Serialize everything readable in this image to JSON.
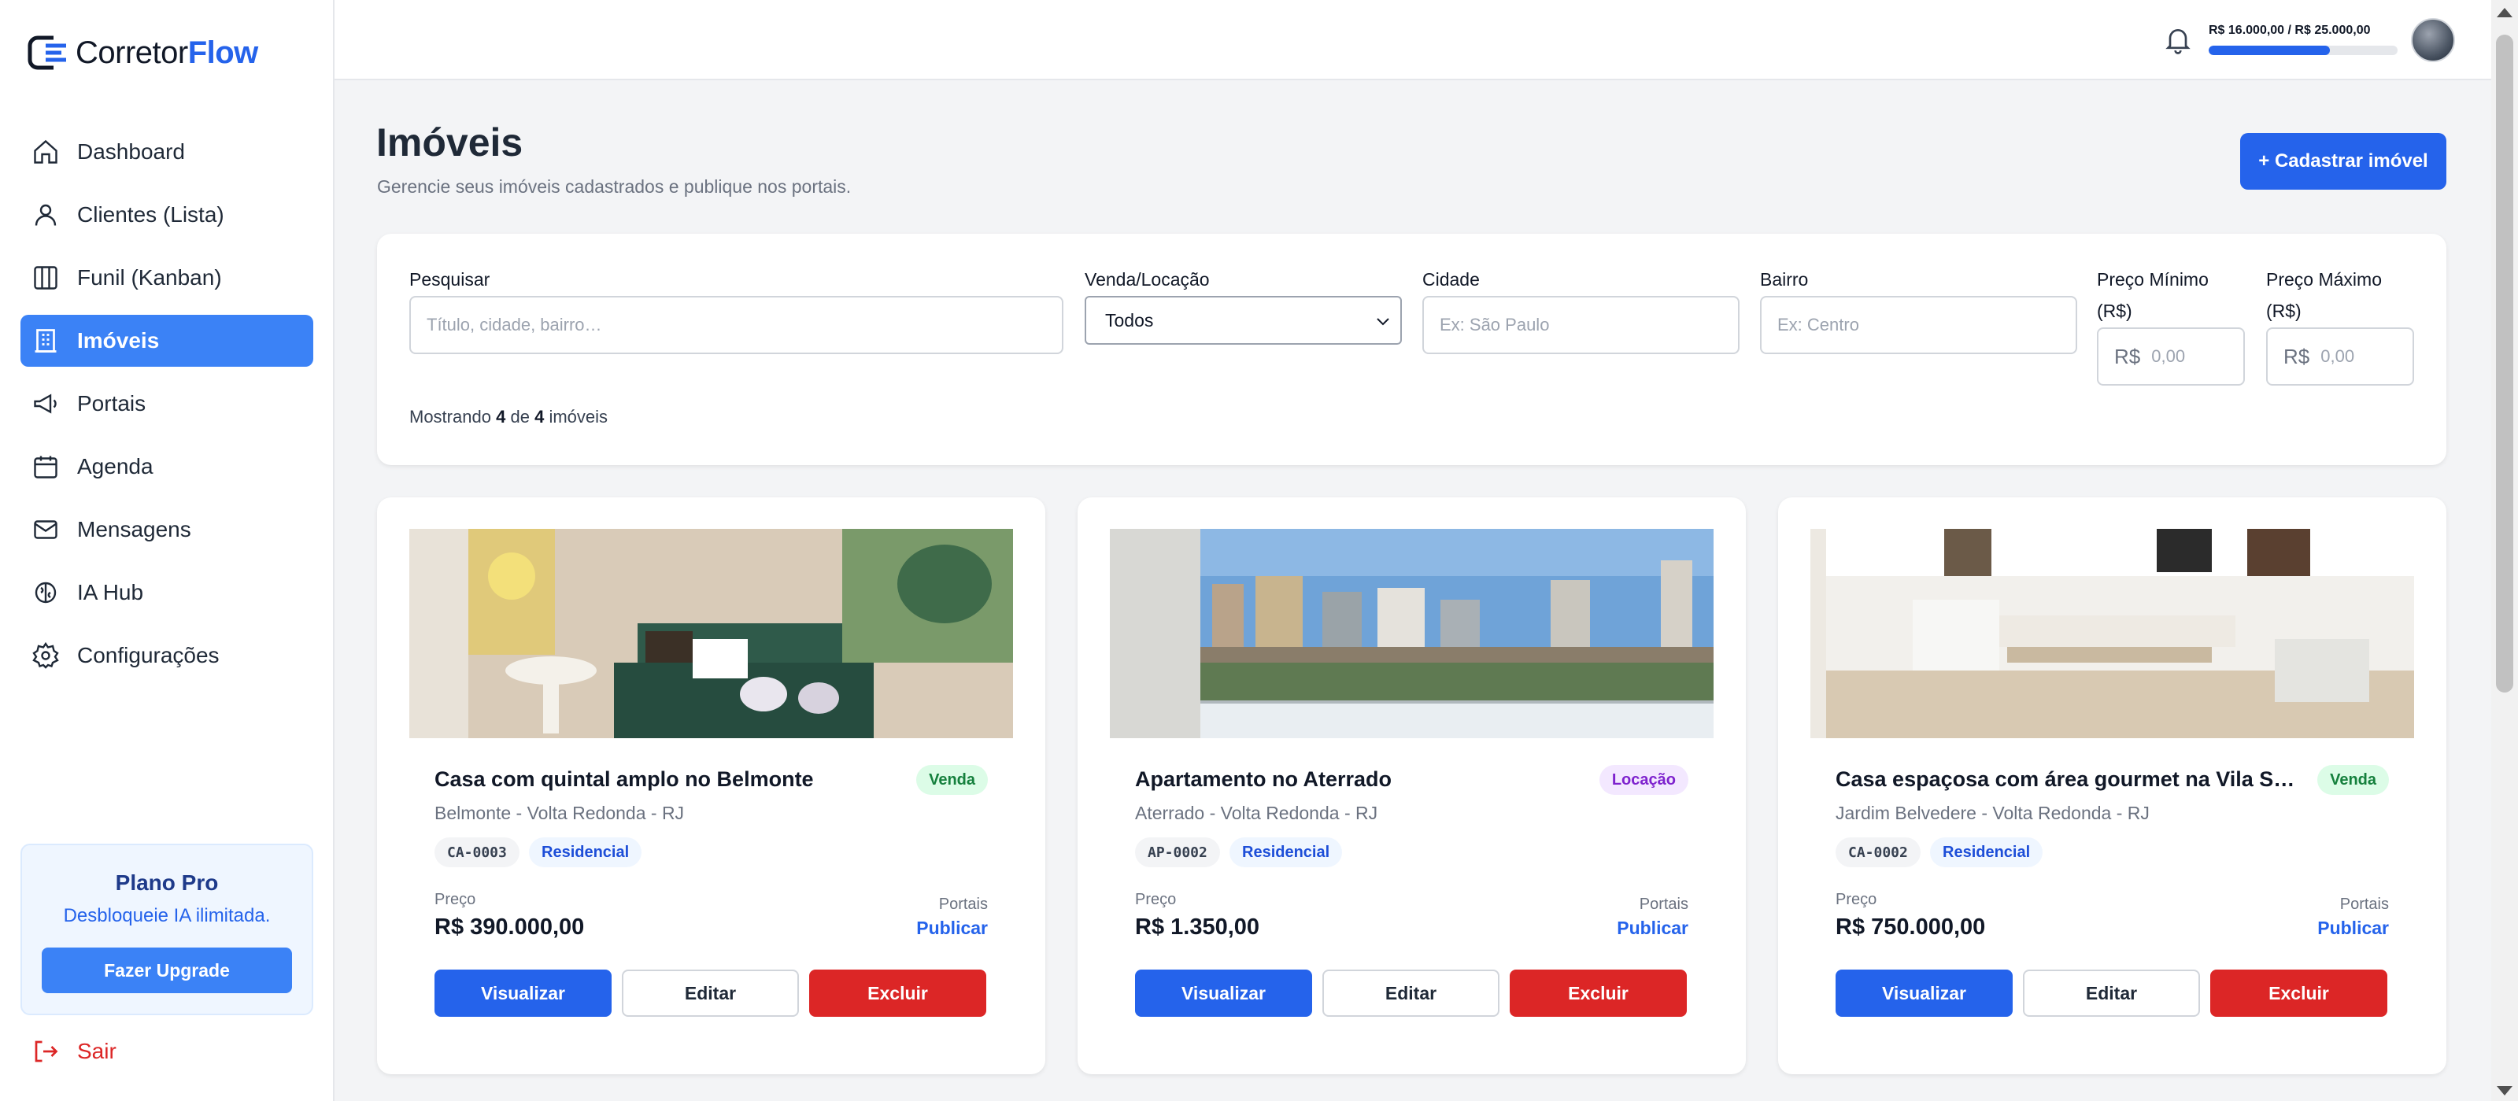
{
  "brand": {
    "name_part1": "Corretor",
    "name_part2": "Flow",
    "accent": "#2563eb"
  },
  "sidebar": {
    "items": [
      {
        "label": "Dashboard",
        "icon": "home-icon"
      },
      {
        "label": "Clientes (Lista)",
        "icon": "user-icon"
      },
      {
        "label": "Funil (Kanban)",
        "icon": "kanban-icon"
      },
      {
        "label": "Imóveis",
        "icon": "building-icon",
        "active": true
      },
      {
        "label": "Portais",
        "icon": "megaphone-icon"
      },
      {
        "label": "Agenda",
        "icon": "calendar-icon"
      },
      {
        "label": "Mensagens",
        "icon": "mail-icon"
      },
      {
        "label": "IA Hub",
        "icon": "brain-icon"
      },
      {
        "label": "Configurações",
        "icon": "gear-icon"
      }
    ],
    "plan": {
      "title": "Plano Pro",
      "subtitle": "Desbloqueie IA ilimitada.",
      "button": "Fazer Upgrade"
    },
    "logout": "Sair"
  },
  "topbar": {
    "usage_text": "R$ 16.000,00 / R$ 25.000,00",
    "usage_fraction": 0.64
  },
  "page": {
    "title": "Imóveis",
    "subtitle": "Gerencie seus imóveis cadastrados e publique nos portais.",
    "add_button": "+ Cadastrar imóvel"
  },
  "filters": {
    "search_label": "Pesquisar",
    "search_placeholder": "Título, cidade, bairro…",
    "type_label": "Venda/Locação",
    "type_value": "Todos",
    "city_label": "Cidade",
    "city_placeholder": "Ex: São Paulo",
    "district_label": "Bairro",
    "district_placeholder": "Ex: Centro",
    "min_label": "Preço Mínimo (R$)",
    "max_label": "Preço Máximo (R$)",
    "currency": "R$",
    "price_placeholder": "0,00",
    "showing_prefix": "Mostrando",
    "showing_count": "4",
    "showing_of": "de",
    "showing_total": "4",
    "showing_suffix": "imóveis"
  },
  "properties": [
    {
      "title": "Casa com quintal amplo no Belmonte",
      "badge": "Venda",
      "location": "Belmonte - Volta Redonda - RJ",
      "code": "CA-0003",
      "type": "Residencial",
      "price_label": "Preço",
      "price": "R$ 390.000,00",
      "portals_label": "Portais",
      "publish": "Publicar",
      "view": "Visualizar",
      "edit": "Editar",
      "delete": "Excluir"
    },
    {
      "title": "Apartamento no Aterrado",
      "badge": "Locação",
      "location": "Aterrado - Volta Redonda - RJ",
      "code": "AP-0002",
      "type": "Residencial",
      "price_label": "Preço",
      "price": "R$ 1.350,00",
      "portals_label": "Portais",
      "publish": "Publicar",
      "view": "Visualizar",
      "edit": "Editar",
      "delete": "Excluir"
    },
    {
      "title": "Casa espaçosa com área gourmet na Vila S…",
      "badge": "Venda",
      "location": "Jardim Belvedere - Volta Redonda - RJ",
      "code": "CA-0002",
      "type": "Residencial",
      "price_label": "Preço",
      "price": "R$ 750.000,00",
      "portals_label": "Portais",
      "publish": "Publicar",
      "view": "Visualizar",
      "edit": "Editar",
      "delete": "Excluir"
    }
  ]
}
